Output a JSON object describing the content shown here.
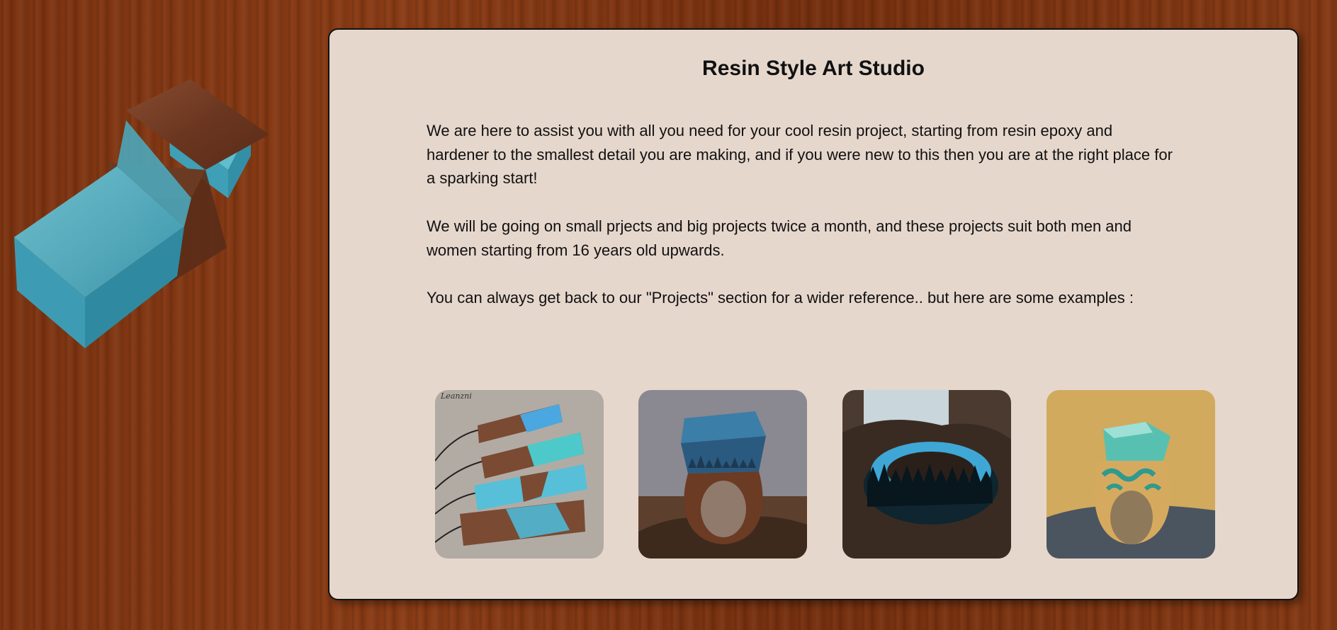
{
  "page": {
    "title": "Resin Style Art Studio",
    "paragraphs": [
      "We are here to assist you with all you need for your cool resin project, starting from resin epoxy and hardener to the smallest detail you are making, and if you were new to this then you are at the right place for a sparking start!",
      "We will be going on small prjects and big projects twice a month, and these projects suit both men and women starting from 16 years old upwards.",
      "You can always get back to our \"Projects\" section for a wider reference.. but here are some examples :"
    ]
  },
  "gallery": {
    "images": [
      {
        "icon": "resin-pendants-image",
        "watermark": "Leanzni"
      },
      {
        "icon": "landscape-ring-image"
      },
      {
        "icon": "forest-band-ring-image"
      },
      {
        "icon": "wave-ring-image"
      }
    ]
  },
  "colors": {
    "background": "#7a3210",
    "panel": "#e6d7cd",
    "resin": "#4fb3c9",
    "wood": "#6e3a22"
  }
}
